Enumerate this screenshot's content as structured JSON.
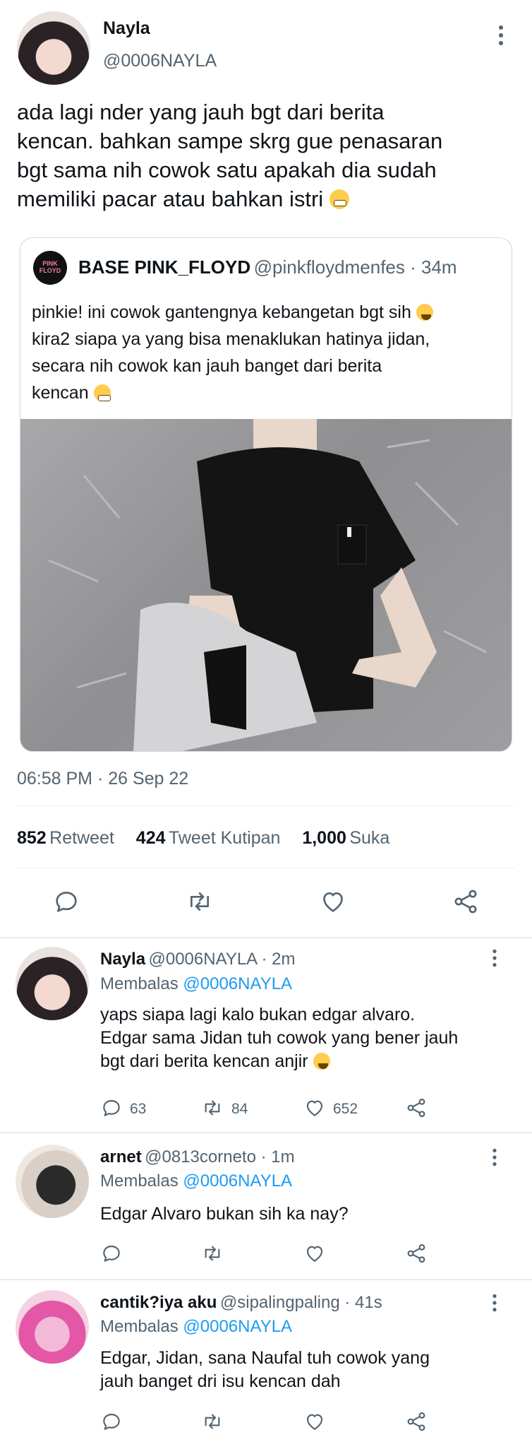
{
  "main_tweet": {
    "author_name": "Nayla",
    "author_handle": "@0006NAYLA",
    "text_lines": [
      "ada lagi nder yang jauh bgt dari berita",
      "kencan. bahkan sampe skrg gue penasaran",
      "bgt sama nih cowok satu apakah dia sudah",
      "memiliki pacar atau bahkan istri"
    ],
    "timestamp": "06:58 PM · 26 Sep 22",
    "stats": {
      "retweets": "852",
      "retweets_label": "Retweet",
      "quotes": "424",
      "quotes_label": "Tweet Kutipan",
      "likes": "1,000",
      "likes_label": "Suka"
    }
  },
  "quoted_tweet": {
    "author_name": "BASE PINK_FLOYD",
    "author_meta": "@pinkfloydmenfes · 34m",
    "avatar_text": "PINK FLOYD",
    "text_lines": [
      "pinkie! ini cowok gantengnya kebangetan bgt sih",
      "kira2 siapa ya yang bisa menaklukan hatinya jidan,",
      "secara nih cowok kan jauh banget dari berita",
      "kencan"
    ]
  },
  "replies": [
    {
      "author_name": "Nayla",
      "author_meta": "@0006NAYLA · 2m",
      "replying_prefix": "Membalas",
      "replying_to": "@0006NAYLA",
      "text_lines": [
        "yaps siapa lagi kalo bukan edgar alvaro.",
        "Edgar sama Jidan tuh cowok yang bener jauh",
        "bgt dari berita kencan anjir"
      ],
      "replies_count": "63",
      "retweets_count": "84",
      "likes_count": "652"
    },
    {
      "author_name": "arnet",
      "author_meta": "@0813corneto · 1m",
      "replying_prefix": "Membalas",
      "replying_to": "@0006NAYLA",
      "text_lines": [
        "Edgar Alvaro bukan sih ka nay?"
      ]
    },
    {
      "author_name": "cantik?iya aku",
      "author_meta": "@sipalingpaling · 41s",
      "replying_prefix": "Membalas",
      "replying_to": "@0006NAYLA",
      "text_lines": [
        "Edgar, Jidan, sana Naufal tuh cowok yang",
        "jauh banget dri isu kencan dah"
      ]
    }
  ],
  "icons": [
    "more-icon",
    "reply-icon",
    "retweet-icon",
    "like-icon",
    "share-icon"
  ],
  "colors": {
    "text": "#0f1419",
    "muted": "#536471",
    "link": "#1d9bf0",
    "border": "#cfd9de"
  }
}
